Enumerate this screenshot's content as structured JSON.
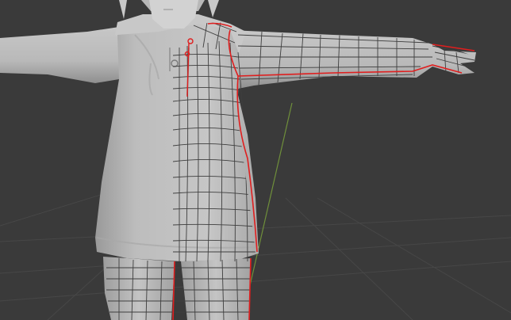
{
  "viewport": {
    "background_color": "#3a3a3a",
    "grid_line_color": "#474747",
    "axis_y_color": "#6f8f3a",
    "mesh_color": "#c2c2c2",
    "mesh_shadow_color": "#8c8c8c",
    "wire_color": "#3e3e3e",
    "seam_color": "#e01e1e"
  },
  "scene": {
    "model": "character-tpose",
    "shading": "solid-with-wireframe-half",
    "selection": "marked-seams"
  }
}
